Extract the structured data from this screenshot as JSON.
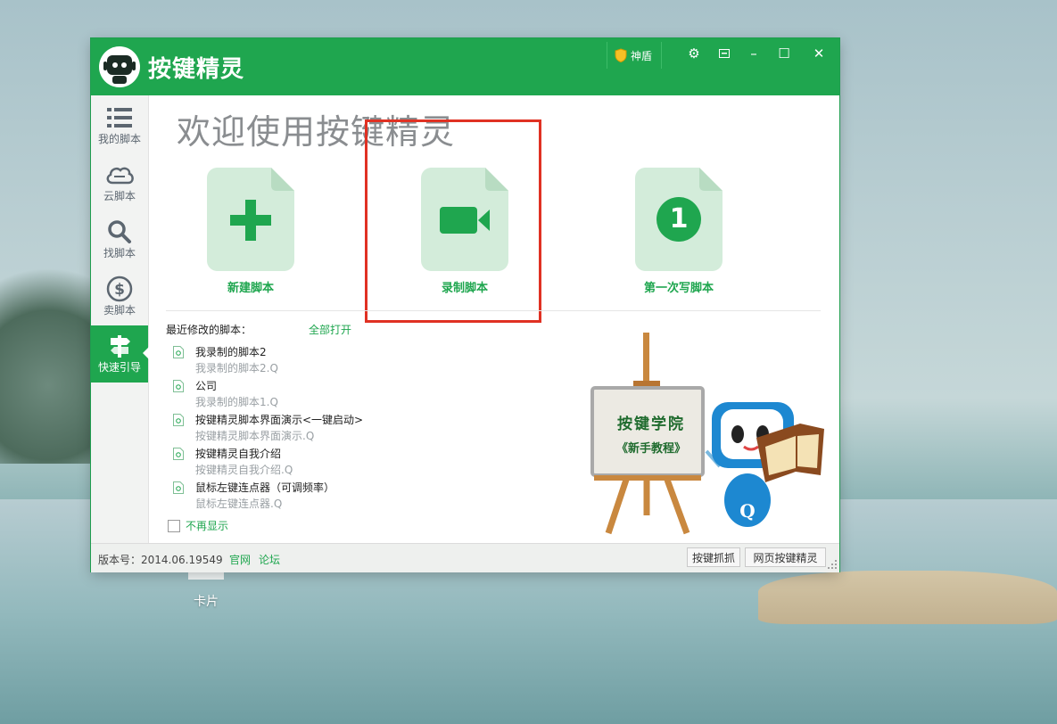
{
  "app": {
    "title": "按键精灵"
  },
  "titlebar": {
    "shield_label": "神盾"
  },
  "sidebar": {
    "items": [
      {
        "label": "我的脚本",
        "icon": "list-icon"
      },
      {
        "label": "云脚本",
        "icon": "cloud-icon"
      },
      {
        "label": "找脚本",
        "icon": "search-icon"
      },
      {
        "label": "卖脚本",
        "icon": "dollar-icon"
      },
      {
        "label": "快速引导",
        "icon": "signpost-icon"
      }
    ]
  },
  "main": {
    "welcome": "欢迎使用按键精灵",
    "cards": [
      {
        "label": "新建脚本",
        "icon": "plus-icon"
      },
      {
        "label": "录制脚本",
        "icon": "video-camera-icon"
      },
      {
        "label": "第一次写脚本",
        "icon": "number-one-icon",
        "badge": "1"
      }
    ],
    "recent": {
      "title": "最近修改的脚本：",
      "open_all": "全部打开",
      "items": [
        {
          "name": "我录制的脚本2",
          "file": "我录制的脚本2.Q"
        },
        {
          "name": "公司",
          "file": "我录制的脚本1.Q"
        },
        {
          "name": "按键精灵脚本界面演示<一键启动>",
          "file": "按键精灵脚本界面演示.Q"
        },
        {
          "name": "按键精灵自我介绍",
          "file": "按键精灵自我介绍.Q"
        },
        {
          "name": "鼠标左键连点器（可调频率）",
          "file": "鼠标左键连点器.Q"
        }
      ]
    },
    "no_show": "不再显示",
    "board": {
      "line1": "按键学院",
      "line2": "《新手教程》"
    }
  },
  "status": {
    "version": "版本号：2014.06.19549",
    "link_official": "官网",
    "link_forum": "论坛",
    "btn_capture": "按键抓抓",
    "btn_web": "网页按键精灵"
  },
  "desktop": {
    "icon_label": "卡片"
  },
  "colors": {
    "brand": "#1fa64f",
    "highlight": "#e03123"
  }
}
